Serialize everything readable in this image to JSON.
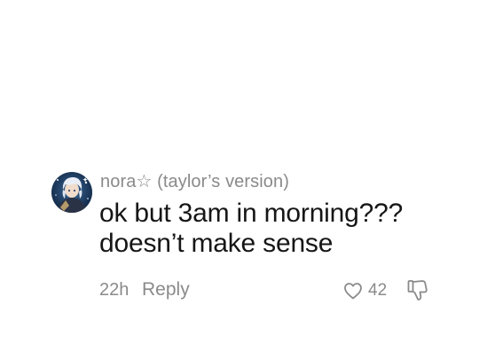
{
  "comment": {
    "username": "nora☆ (taylor’s version)",
    "text": "ok but 3am in morning???\ndoesn’t make sense",
    "time": "22h",
    "reply_label": "Reply",
    "like_count": "42"
  },
  "icons": {
    "like": "heart-outline-icon",
    "dislike": "thumbs-down-outline-icon"
  },
  "colors": {
    "text": "#161616",
    "muted": "#8a8a8a",
    "background": "#ffffff"
  }
}
